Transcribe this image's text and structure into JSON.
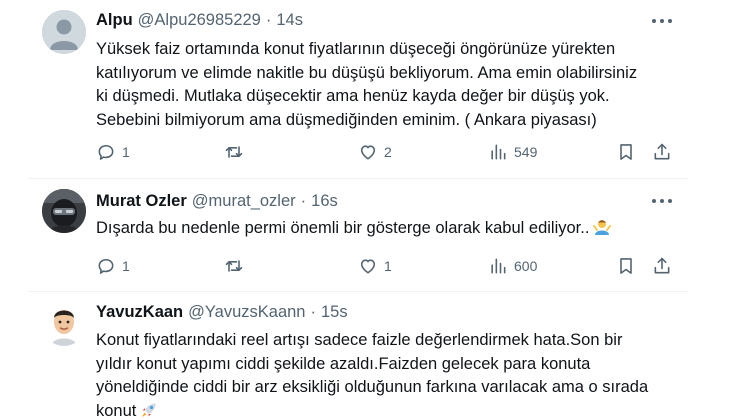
{
  "tweets": [
    {
      "name": "Alpu",
      "handle": "@Alpu26985229",
      "separator": "·",
      "time": "14s",
      "lines": [
        "Yüksek faiz ortamında konut fiyatlarının düşeceği öngörünüze yürekten",
        "katılıyorum ve elimde nakitle bu düşüşü bekliyorum. Ama emin olabilirsiniz",
        "ki düşmedi. Mutlaka düşecektir ama henüz kayda değer bir düşüş yok.",
        "Sebebini bilmiyorum ama düşmediğinden eminim. ( Ankara piyasası)"
      ],
      "replies": "1",
      "retweets": "",
      "likes": "2",
      "views": "549"
    },
    {
      "name": "Murat Ozler",
      "handle": "@murat_ozler",
      "separator": "·",
      "time": "16s",
      "lines": [
        "Dışarda bu nedenle permi önemli bir gösterge olarak kabul ediliyor.."
      ],
      "emoji": "person-shrugging-emoji",
      "replies": "1",
      "retweets": "",
      "likes": "1",
      "views": "600"
    },
    {
      "name": "YavuzKaan",
      "handle": "@YavuzsKaann",
      "separator": "·",
      "time": "15s",
      "lines": [
        "Konut fiyatlarındaki reel artışı sadece faizle değerlendirmek hata.Son bir",
        "yıldır konut yapımı ciddi şekilde azaldı.Faizden gelecek para konuta",
        "yöneldiğinde ciddi bir arz eksikliği olduğunun farkına varılacak ama o sırada",
        "konut"
      ],
      "emoji": "rocket-emoji"
    }
  ],
  "colors": {
    "text": "#0f1419",
    "secondary": "#536471",
    "divider": "#eff3f4"
  }
}
